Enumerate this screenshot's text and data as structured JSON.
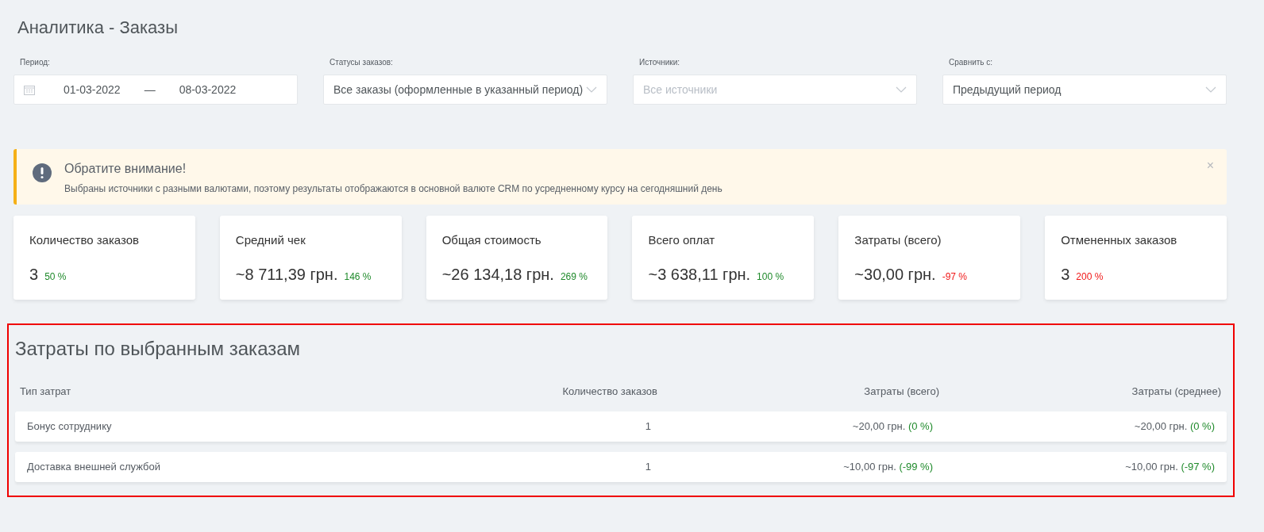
{
  "page_title": "Аналитика - Заказы",
  "filters": [
    {
      "kind": "daterange",
      "label": "Период:",
      "from": "01-03-2022",
      "separator": "—",
      "to": "08-03-2022"
    },
    {
      "kind": "select",
      "label": "Статусы заказов:",
      "value": "Все заказы (оформленные в указанный период)"
    },
    {
      "kind": "select",
      "label": "Источники:",
      "placeholder": "Все источники"
    },
    {
      "kind": "select",
      "label": "Сравнить с:",
      "value": "Предыдущий период"
    }
  ],
  "alert": {
    "title": "Обратите внимание!",
    "text": "Выбраны источники с разными валютами, поэтому результаты отображаются в основной валюте CRM по усредненному курсу на сегодняшний день",
    "close": "×"
  },
  "stats": [
    {
      "label": "Количество заказов",
      "value": "3",
      "change": "50 %",
      "color": "#1f8a2b"
    },
    {
      "label": "Средний чек",
      "value": "~8 711,39 грн.",
      "change": "146 %",
      "color": "#1f8a2b"
    },
    {
      "label": "Общая стоимость",
      "value": "~26 134,18 грн.",
      "change": "269 %",
      "color": "#1f8a2b"
    },
    {
      "label": "Всего оплат",
      "value": "~3 638,11 грн.",
      "change": "100 %",
      "color": "#1f8a2b"
    },
    {
      "label": "Затраты (всего)",
      "value": "~30,00 грн.",
      "change": "-97 %",
      "color": "#f01818"
    },
    {
      "label": "Отмененных заказов",
      "value": "3",
      "change": "200 %",
      "color": "#f01818"
    }
  ],
  "costs": {
    "title": "Затраты по выбранным заказам",
    "highlighted": true,
    "columns": [
      "Тип затрат",
      "Количество заказов",
      "Затраты (всего)",
      "Затраты (среднее)"
    ],
    "rows": [
      {
        "type": "Бонус сотруднику",
        "count": "1",
        "total": "~20,00 грн.",
        "total_change": "(0 %)",
        "average": "~20,00 грн.",
        "average_change": "(0 %)"
      },
      {
        "type": "Доставка внешней службой",
        "count": "1",
        "total": "~10,00 грн.",
        "total_change": "(-99 %)",
        "average": "~10,00 грн.",
        "average_change": "(-97 %)"
      }
    ]
  }
}
